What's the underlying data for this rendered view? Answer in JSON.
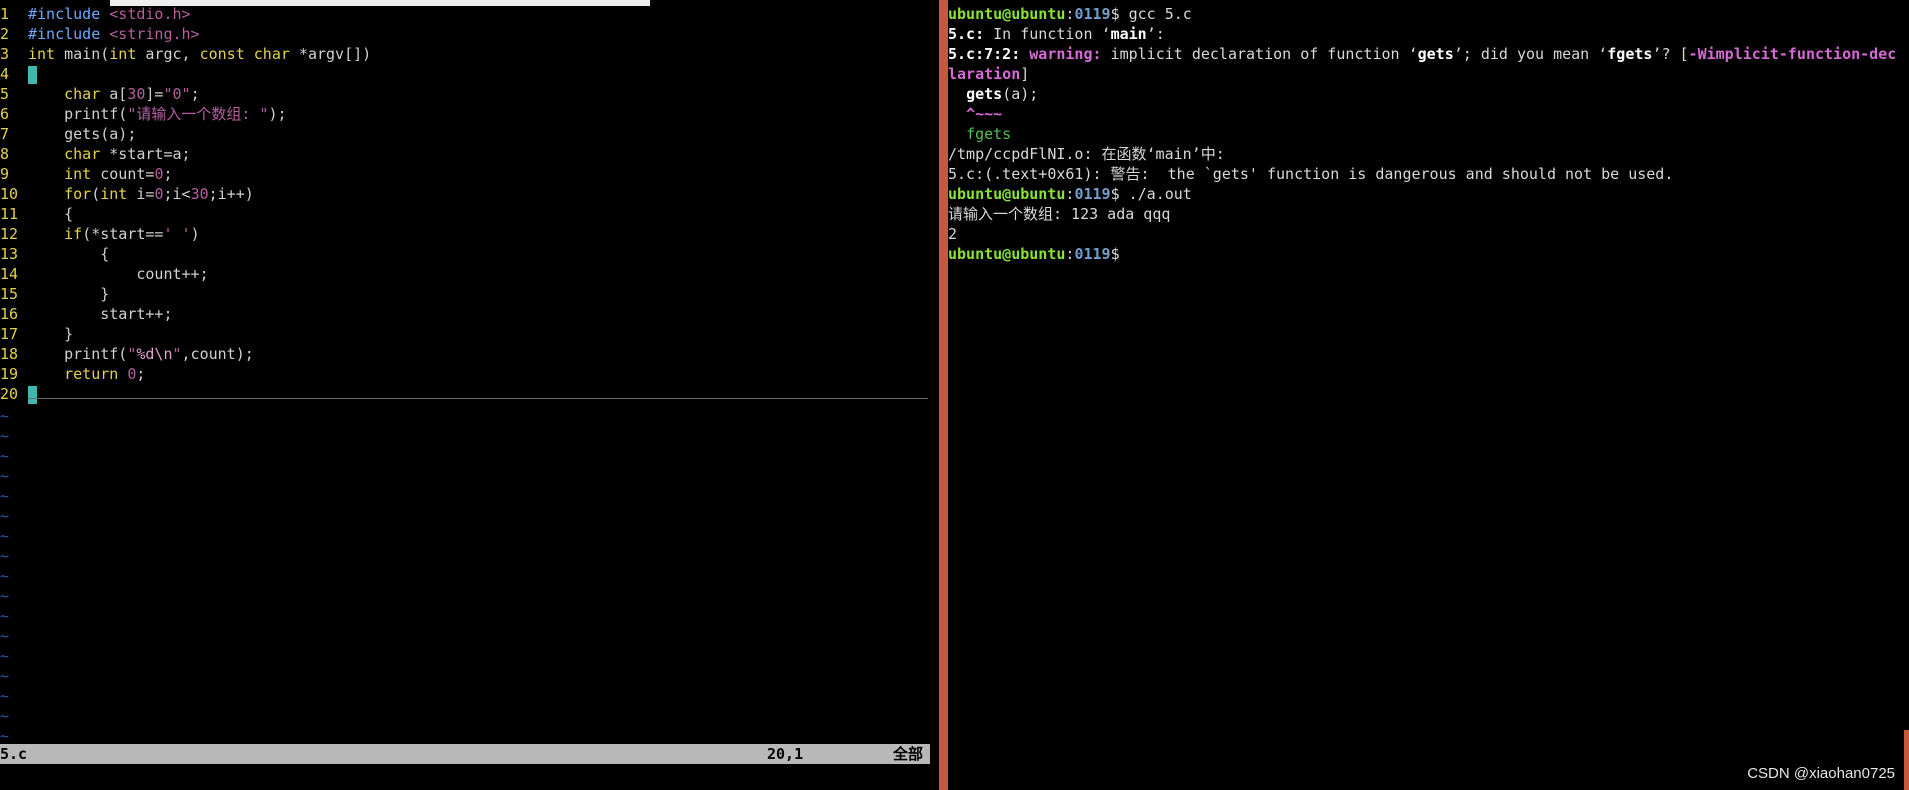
{
  "editor": {
    "lines": [
      {
        "n": "1",
        "parts": [
          [
            "pp",
            "#include "
          ],
          [
            "str",
            "<stdio.h>"
          ]
        ]
      },
      {
        "n": "2",
        "parts": [
          [
            "pp",
            "#include "
          ],
          [
            "str",
            "<string.h>"
          ]
        ]
      },
      {
        "n": "3",
        "parts": [
          [
            "kw",
            "int"
          ],
          [
            "code",
            " main("
          ],
          [
            "kw",
            "int"
          ],
          [
            "code",
            " argc, "
          ],
          [
            "kw",
            "const char"
          ],
          [
            "code",
            " *argv[])"
          ]
        ]
      },
      {
        "n": "4",
        "parts": [
          [
            "cursor",
            "{"
          ]
        ]
      },
      {
        "n": "5",
        "parts": [
          [
            "code",
            "    "
          ],
          [
            "kw",
            "char"
          ],
          [
            "code",
            " a["
          ],
          [
            "num",
            "30"
          ],
          [
            "code",
            "]="
          ],
          [
            "str",
            "\"0\""
          ],
          [
            "code",
            ";"
          ]
        ]
      },
      {
        "n": "6",
        "parts": [
          [
            "code",
            "    printf("
          ],
          [
            "str",
            "\"请输入一个数组: \""
          ],
          [
            "code",
            ");"
          ]
        ]
      },
      {
        "n": "7",
        "parts": [
          [
            "code",
            "    gets(a);"
          ]
        ]
      },
      {
        "n": "8",
        "parts": [
          [
            "code",
            "    "
          ],
          [
            "kw",
            "char"
          ],
          [
            "code",
            " *start=a;"
          ]
        ]
      },
      {
        "n": "9",
        "parts": [
          [
            "code",
            "    "
          ],
          [
            "kw",
            "int"
          ],
          [
            "code",
            " count="
          ],
          [
            "num",
            "0"
          ],
          [
            "code",
            ";"
          ]
        ]
      },
      {
        "n": "10",
        "parts": [
          [
            "code",
            "    "
          ],
          [
            "kw",
            "for"
          ],
          [
            "code",
            "("
          ],
          [
            "kw",
            "int"
          ],
          [
            "code",
            " i="
          ],
          [
            "num",
            "0"
          ],
          [
            "code",
            ";i<"
          ],
          [
            "num",
            "30"
          ],
          [
            "code",
            ";i++)"
          ]
        ]
      },
      {
        "n": "11",
        "parts": [
          [
            "code",
            "    {"
          ]
        ]
      },
      {
        "n": "12",
        "parts": [
          [
            "code",
            "    "
          ],
          [
            "kw",
            "if"
          ],
          [
            "code",
            "(*start=="
          ],
          [
            "str",
            "' '"
          ],
          [
            "code",
            ")"
          ]
        ]
      },
      {
        "n": "13",
        "parts": [
          [
            "code",
            "        {"
          ]
        ]
      },
      {
        "n": "14",
        "parts": [
          [
            "code",
            "            count++;"
          ]
        ]
      },
      {
        "n": "15",
        "parts": [
          [
            "code",
            "        }"
          ]
        ]
      },
      {
        "n": "16",
        "parts": [
          [
            "code",
            "        start++;"
          ]
        ]
      },
      {
        "n": "17",
        "parts": [
          [
            "code",
            "    }"
          ]
        ]
      },
      {
        "n": "18",
        "parts": [
          [
            "code",
            "    printf("
          ],
          [
            "str",
            "\""
          ],
          [
            "esc",
            "%d\\n"
          ],
          [
            "str",
            "\""
          ],
          [
            "code",
            ",count);"
          ]
        ]
      },
      {
        "n": "19",
        "parts": [
          [
            "code",
            "    "
          ],
          [
            "kw",
            "return"
          ],
          [
            "code",
            " "
          ],
          [
            "num",
            "0"
          ],
          [
            "code",
            ";"
          ]
        ]
      },
      {
        "n": "20",
        "parts": [
          [
            "cursor",
            "}"
          ]
        ]
      }
    ],
    "tilde_count": 17,
    "status": {
      "filename": "5.c",
      "position": "20,1",
      "scroll": "全部"
    }
  },
  "terminal": {
    "lines": [
      [
        [
          "user",
          "ubuntu@ubuntu"
        ],
        [
          "plain",
          ":"
        ],
        [
          "path",
          "0119"
        ],
        [
          "plain",
          "$ gcc 5.c"
        ]
      ],
      [
        [
          "bold",
          "5.c:"
        ],
        [
          "plain",
          " In function ‘"
        ],
        [
          "bold",
          "main"
        ],
        [
          "plain",
          "’:"
        ]
      ],
      [
        [
          "bold",
          "5.c:7:2:"
        ],
        [
          "plain",
          " "
        ],
        [
          "warn",
          "warning:"
        ],
        [
          "plain",
          " implicit declaration of function ‘"
        ],
        [
          "bold",
          "gets"
        ],
        [
          "plain",
          "’; did you mean ‘"
        ],
        [
          "bold",
          "fgets"
        ],
        [
          "plain",
          "’? ["
        ],
        [
          "warn",
          "-Wimplicit-function-dec"
        ]
      ],
      [
        [
          "warn",
          "laration"
        ],
        [
          "plain",
          "]"
        ]
      ],
      [
        [
          "plain",
          "  "
        ],
        [
          "bold",
          "gets"
        ],
        [
          "plain",
          "(a);"
        ]
      ],
      [
        [
          "plain",
          "  "
        ],
        [
          "warn",
          "^~~~"
        ]
      ],
      [
        [
          "plain",
          "  "
        ],
        [
          "grn",
          "fgets"
        ]
      ],
      [
        [
          "plain",
          "/tmp/ccpdFlNI.o: 在函数‘main’中:"
        ]
      ],
      [
        [
          "plain",
          "5.c:(.text+0x61): 警告:  the `gets' function is dangerous and should not be used."
        ]
      ],
      [
        [
          "user",
          "ubuntu@ubuntu"
        ],
        [
          "plain",
          ":"
        ],
        [
          "path",
          "0119"
        ],
        [
          "plain",
          "$ ./a.out"
        ]
      ],
      [
        [
          "plain",
          "请输入一个数组: 123 ada qqq"
        ]
      ],
      [
        [
          "plain",
          "2"
        ]
      ],
      [
        [
          "user",
          "ubuntu@ubuntu"
        ],
        [
          "plain",
          ":"
        ],
        [
          "path",
          "0119"
        ],
        [
          "plain",
          "$"
        ]
      ]
    ]
  },
  "watermark": "CSDN @xiaohan0725"
}
